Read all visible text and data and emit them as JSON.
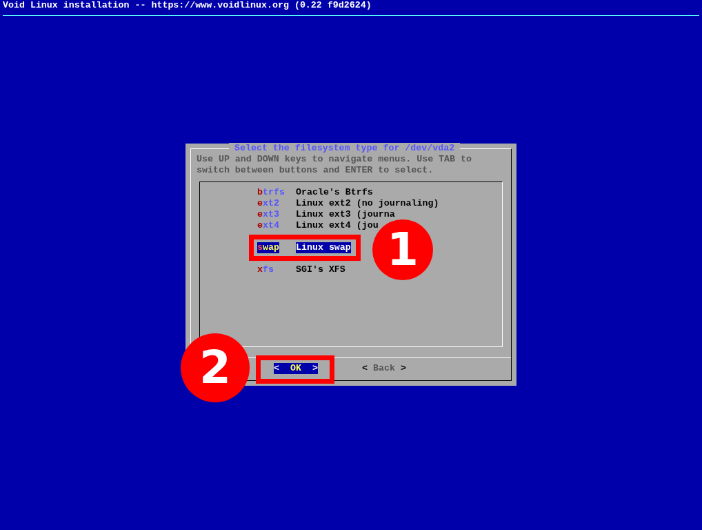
{
  "header": {
    "title": "Void Linux installation -- https://www.voidlinux.org (0.22 f9d2624)"
  },
  "dialog": {
    "title": "Select the filesystem type for /dev/vda2",
    "instructions": "Use UP and DOWN keys to navigate menus. Use TAB to switch between buttons and ENTER to select.",
    "menu": [
      {
        "tag": "btrfs",
        "description": "Oracle's Btrfs",
        "selected": false
      },
      {
        "tag": "ext2",
        "description": "Linux ext2 (no journaling)",
        "selected": false
      },
      {
        "tag": "ext3",
        "description": "Linux ext3 (journa",
        "selected": false
      },
      {
        "tag": "ext4",
        "description": "Linux ext4 (jou",
        "selected": false
      },
      {
        "kind": "covered"
      },
      {
        "tag": "swap",
        "description": "Linux swap",
        "selected": true
      },
      {
        "kind": "covered"
      },
      {
        "tag": "xfs",
        "description": "SGI's XFS",
        "selected": false
      }
    ],
    "buttons": [
      {
        "left": "<",
        "label": "OK",
        "right": ">",
        "selected": true
      },
      {
        "left": "<",
        "label": "Back",
        "right": ">",
        "selected": false
      }
    ]
  },
  "annotations": [
    {
      "label": "1"
    },
    {
      "label": "2"
    }
  ]
}
